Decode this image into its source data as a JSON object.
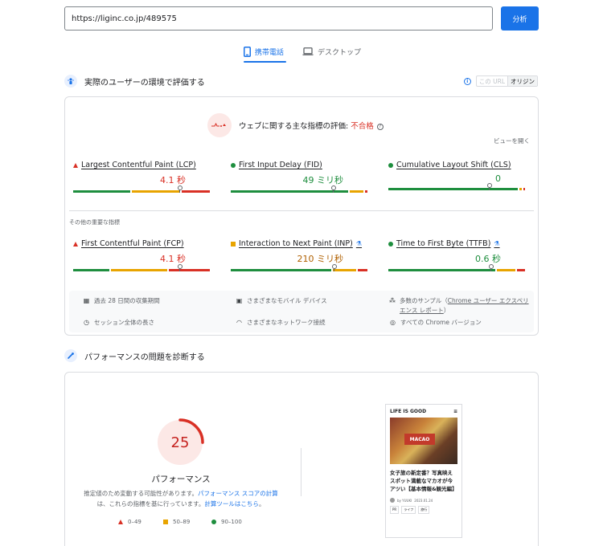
{
  "search": {
    "url": "https://liginc.co.jp/489575",
    "analyze_label": "分析"
  },
  "tabs": [
    {
      "label": "携帯電話",
      "icon": "phone-icon",
      "active": true
    },
    {
      "label": "デスクトップ",
      "icon": "laptop-icon",
      "active": false
    }
  ],
  "field_section": {
    "title": "実際のユーザーの環境で評価する",
    "url_toggle": {
      "this_url": "この URL",
      "origin": "オリジン"
    },
    "assessment": {
      "prefix": "ウェブに関する主な指標の評価: ",
      "result": "不合格"
    },
    "expand_label": "ビューを開く",
    "core_metrics": [
      {
        "name": "Largest Contentful Paint (LCP)",
        "value": "4.1 秒",
        "status": "poor",
        "dist": [
          0.43,
          0.36,
          0.21
        ],
        "marker": 0.78
      },
      {
        "name": "First Input Delay (FID)",
        "value": "49 ミリ秒",
        "status": "good",
        "dist": [
          0.88,
          0.1,
          0.02
        ],
        "marker": 0.75
      },
      {
        "name": "Cumulative Layout Shift (CLS)",
        "value": "0",
        "status": "good",
        "dist": [
          0.97,
          0.02,
          0.01
        ],
        "marker": 0.74
      }
    ],
    "other_label": "その他の重要な指標",
    "other_metrics": [
      {
        "name": "First Contentful Paint (FCP)",
        "value": "4.1 秒",
        "status": "poor",
        "dist": [
          0.27,
          0.42,
          0.31
        ],
        "marker": 0.78,
        "experimental": false
      },
      {
        "name": "Interaction to Next Paint (INP)",
        "value": "210 ミリ秒",
        "status": "needs-improvement",
        "dist": [
          0.75,
          0.18,
          0.07
        ],
        "marker": 0.76,
        "experimental": true
      },
      {
        "name": "Time to First Byte (TTFB)",
        "value": "0.6 秒",
        "status": "good",
        "dist": [
          0.8,
          0.14,
          0.06
        ],
        "marker": 0.75,
        "experimental": true
      }
    ],
    "info": {
      "period": "過去 28 日間の収集期間",
      "devices": "さまざまなモバイル デバイス",
      "samples_prefix": "多数のサンプル（",
      "samples_link": "Chrome ユーザー エクスペリエンス レポート",
      "samples_suffix": "）",
      "session": "セッション全体の長さ",
      "network": "さまざまなネットワーク接続",
      "chrome": "すべての Chrome バージョン"
    }
  },
  "lab_section": {
    "title": "パフォーマンスの問題を診断する",
    "score": "25",
    "score_fraction": 0.25,
    "score_label": "パフォーマンス",
    "note_part1": "推定値のため変動する可能性があります。",
    "note_link1": "パフォーマンス スコアの計算",
    "note_part2": "は、これらの指標を基に行っています。",
    "note_link2": "計算ツールはこちら",
    "note_part3": "。",
    "legend": {
      "poor": "0–49",
      "average": "50–89",
      "good": "90–100"
    },
    "screenshot": {
      "site": "LIFE IS GOOD",
      "banner": "MACAO",
      "headline": "女子旅の新定番？写真映えスポット満載なマカオが今アツい【基本情報&観光編】",
      "author": "by YUUKI",
      "date": "2023.01.24",
      "tags": [
        "PR",
        "ライフ",
        "旅行"
      ]
    }
  },
  "colors": {
    "accent": "#1a73e8",
    "poor": "#d93025",
    "average": "#e8a400",
    "good": "#1e8e3e"
  }
}
